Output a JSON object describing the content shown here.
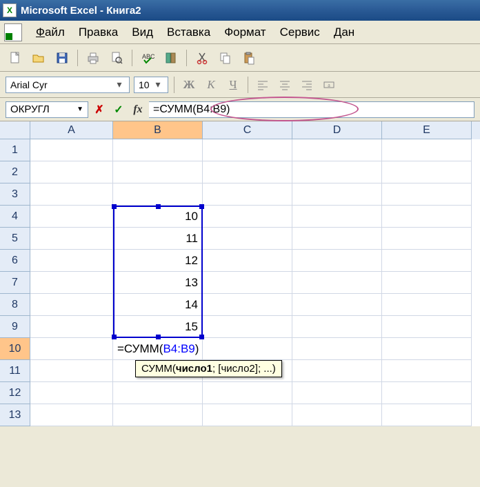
{
  "title": "Microsoft Excel - Книга2",
  "menu": {
    "file": "Файл",
    "edit": "Правка",
    "view": "Вид",
    "insert": "Вставка",
    "format": "Формат",
    "tools": "Сервис",
    "data": "Дан"
  },
  "formatting": {
    "font_name": "Arial Cyr",
    "font_size": "10",
    "bold": "Ж",
    "italic": "К",
    "underline": "Ч"
  },
  "formula_bar": {
    "name_box": "ОКРУГЛ",
    "formula": "=СУММ(B4:B9)"
  },
  "columns": [
    "A",
    "B",
    "C",
    "D",
    "E"
  ],
  "rows": [
    "1",
    "2",
    "3",
    "4",
    "5",
    "6",
    "7",
    "8",
    "9",
    "10",
    "11",
    "12",
    "13"
  ],
  "cells": {
    "B4": "10",
    "B5": "11",
    "B6": "12",
    "B7": "13",
    "B8": "14",
    "B9": "15",
    "B10_prefix": "=СУММ(",
    "B10_ref": "B4:B9",
    "B10_suffix": ")"
  },
  "tooltip": {
    "fn": "СУММ",
    "arg1": "число1",
    "rest": "; [число2]; ...)"
  },
  "chart_data": {
    "type": "table",
    "title": "Spreadsheet range B4:B9 with SUM formula in B10",
    "columns": [
      "B"
    ],
    "rows": [
      {
        "row": 4,
        "B": 10
      },
      {
        "row": 5,
        "B": 11
      },
      {
        "row": 6,
        "B": 12
      },
      {
        "row": 7,
        "B": 13
      },
      {
        "row": 8,
        "B": 14
      },
      {
        "row": 9,
        "B": 15
      }
    ],
    "formula_cell": {
      "address": "B10",
      "formula": "=СУММ(B4:B9)"
    }
  }
}
